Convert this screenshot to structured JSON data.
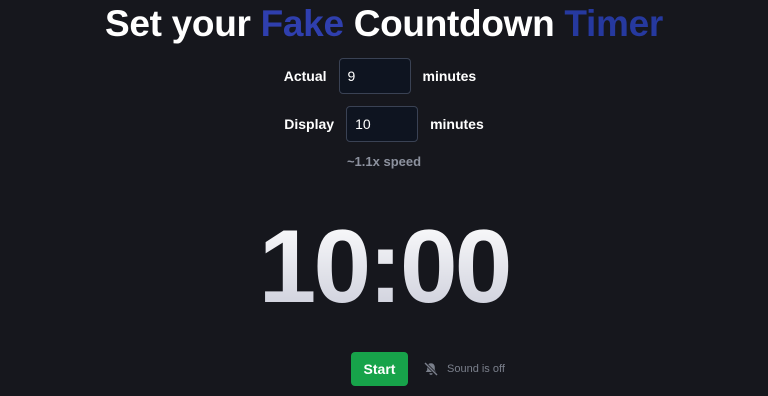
{
  "title": {
    "part1": "Set your ",
    "part2": "Fake",
    "part3": " Countdown ",
    "part4": "Timer"
  },
  "actual": {
    "label": "Actual",
    "value": "9",
    "unit": "minutes"
  },
  "display": {
    "label": "Display",
    "value": "10",
    "unit": "minutes"
  },
  "speed_text": "~1.1x speed",
  "timer_text": "10:00",
  "controls": {
    "start_label": "Start",
    "sound_label": "Sound is off",
    "sound_icon": "bell-off-icon"
  },
  "colors": {
    "background": "#16171d",
    "accent": "#2f3fae",
    "start": "#17a34a"
  }
}
